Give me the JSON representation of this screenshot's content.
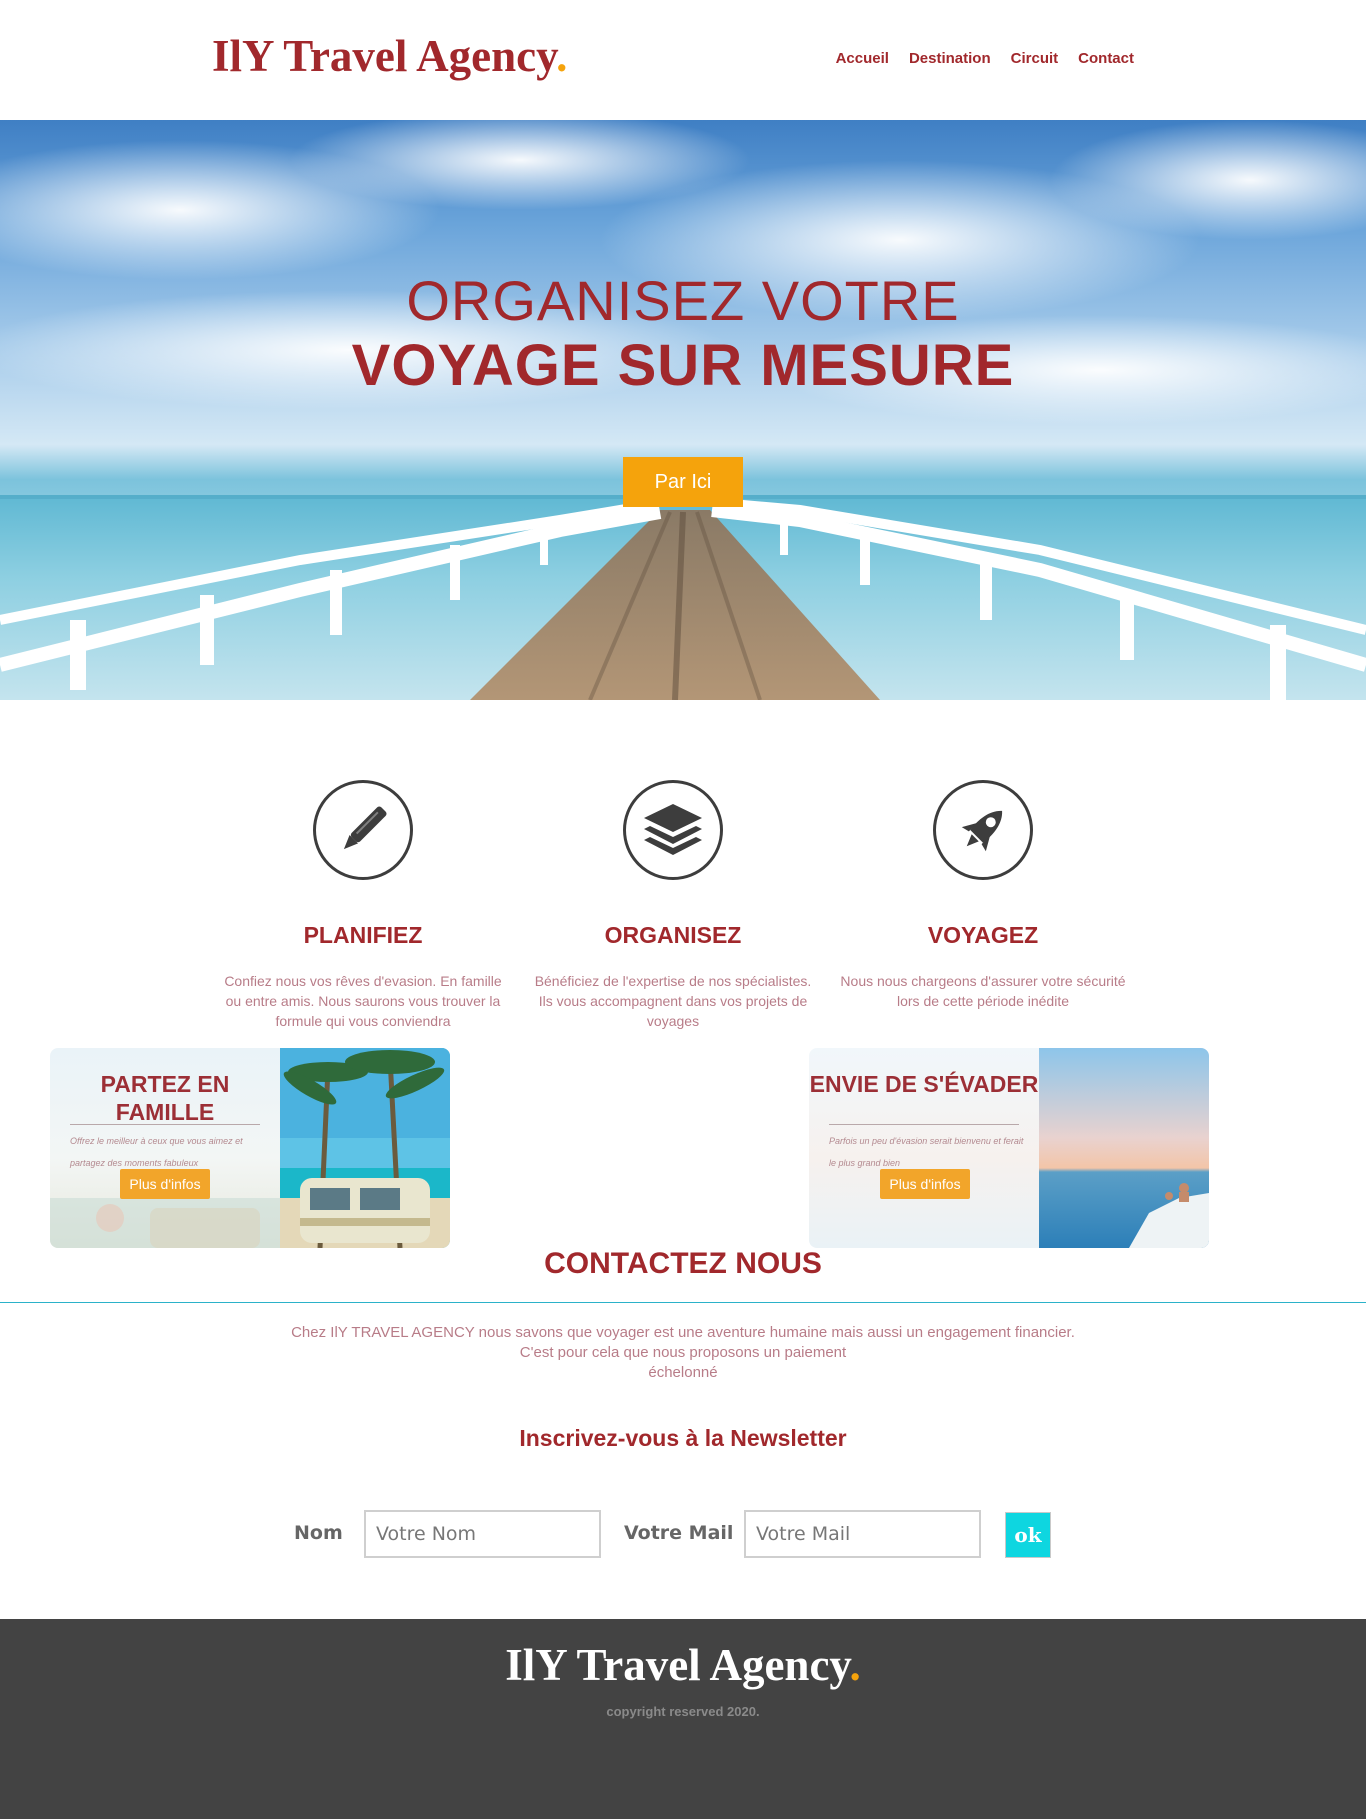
{
  "header": {
    "logo_text": "IlY Travel Agency",
    "logo_dot": ".",
    "nav": [
      {
        "label": "Accueil"
      },
      {
        "label": "Destination"
      },
      {
        "label": "Circuit"
      },
      {
        "label": "Contact"
      }
    ]
  },
  "hero": {
    "title_line1": "ORGANISEZ VOTRE",
    "title_line2": "VOYAGE SUR MESURE",
    "button_label": "Par Ici"
  },
  "features": [
    {
      "icon": "pen-icon",
      "title": "PLANIFIEZ",
      "text": "Confiez nous vos rêves d'evasion. En famille ou entre amis. Nous saurons vous trouver la formule qui vous conviendra"
    },
    {
      "icon": "layers-icon",
      "title": "ORGANISEZ",
      "text": "Bénéficiez de l'expertise de nos spécialistes. Ils vous accompagnent dans vos projets de voyages"
    },
    {
      "icon": "rocket-icon",
      "title": "VOYAGEZ",
      "text": "Nous nous chargeons d'assurer votre sécurité lors de cette période inédite"
    }
  ],
  "cards": [
    {
      "title": "PARTEZ EN FAMILLE",
      "desc": "Offrez le meilleur à ceux que vous aimez et partagez des moments fabuleux",
      "button_label": "Plus d'infos"
    },
    {
      "title": "ENVIE DE S'ÉVADER",
      "desc": "Parfois un peu d'évasion serait bienvenu et ferait le plus grand bien",
      "button_label": "Plus d'infos"
    }
  ],
  "contact": {
    "title": "CONTACTEZ NOUS",
    "text_line1": "Chez IlY TRAVEL AGENCY nous savons que voyager est une aventure humaine mais aussi un engagement financier.",
    "text_line2": "C'est pour cela que nous proposons un paiement",
    "text_line3": "échelonné"
  },
  "newsletter": {
    "title": "Inscrivez-vous à la Newsletter",
    "name_label": "Nom",
    "name_placeholder": "Votre Nom",
    "mail_label": "Votre Mail",
    "mail_placeholder": "Votre Mail",
    "submit_label": "ok"
  },
  "footer": {
    "logo_text": "IlY Travel Agency",
    "logo_dot": ".",
    "copyright": "copyright reserved 2020."
  },
  "colors": {
    "brand": "#a1282c",
    "accent": "#f5a30c",
    "teal": "#0ed6e0",
    "footer_bg": "#434343"
  }
}
